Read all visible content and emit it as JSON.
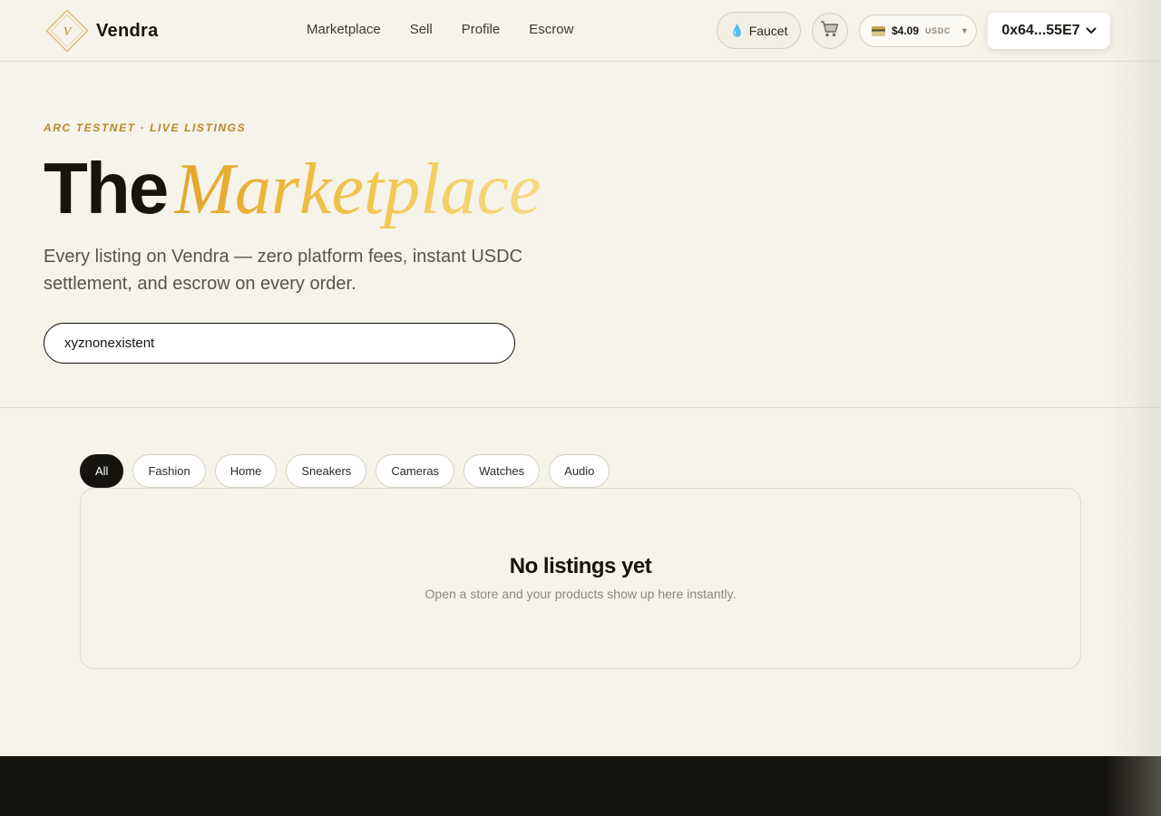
{
  "brand": {
    "name": "Vendra",
    "logo_letter": "V"
  },
  "nav": {
    "items": [
      "Marketplace",
      "Sell",
      "Profile",
      "Escrow"
    ]
  },
  "header": {
    "faucet_label": "Faucet",
    "balance_amount": "$4.09",
    "balance_unit": "USDC",
    "wallet_address": "0x64...55E7"
  },
  "hero": {
    "eyebrow": "ARC TESTNET · LIVE LISTINGS",
    "title_plain": "The",
    "title_accent": "Marketplace",
    "subtitle": "Every listing on Vendra — zero platform fees, instant USDC settlement, and escrow on every order."
  },
  "search": {
    "value": "xyznonexistent"
  },
  "categories": [
    "All",
    "Fashion",
    "Home",
    "Sneakers",
    "Cameras",
    "Watches",
    "Audio"
  ],
  "empty_state": {
    "title": "No listings yet",
    "subtitle": "Open a store and your products show up here instantly."
  },
  "colors": {
    "background": "#f6f3ea",
    "accent_gold": "#e2a528",
    "ink": "#16140f"
  },
  "icons": [
    "logo-diamond-icon",
    "water-drop-icon",
    "cart-icon",
    "card-icon",
    "chevron-down-icon"
  ]
}
